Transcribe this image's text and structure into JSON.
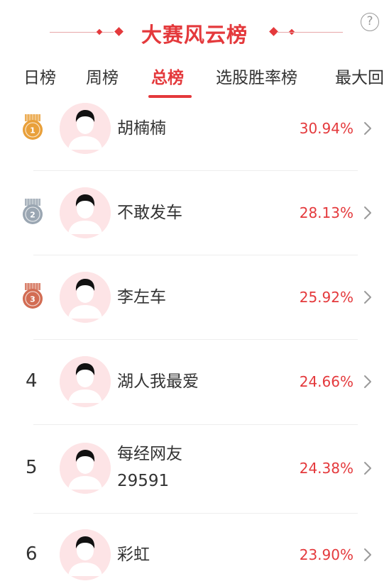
{
  "header": {
    "title": "大赛风云榜",
    "help_symbol": "?"
  },
  "tabs": [
    {
      "label": "日榜",
      "active": false
    },
    {
      "label": "周榜",
      "active": false
    },
    {
      "label": "总榜",
      "active": true
    },
    {
      "label": "选股胜率榜",
      "active": false
    },
    {
      "label": "最大回",
      "active": false
    }
  ],
  "colors": {
    "accent": "#e4393c",
    "gold": "#e9a03a",
    "silver": "#9aa6b2",
    "bronze": "#d26c53",
    "avatar_bg": "#fde4e6"
  },
  "ranking": [
    {
      "rank": "1",
      "medal": "gold",
      "name": "胡楠楠",
      "name_line2": "",
      "rate": "30.94%"
    },
    {
      "rank": "2",
      "medal": "silver",
      "name": "不敢发车",
      "name_line2": "",
      "rate": "28.13%"
    },
    {
      "rank": "3",
      "medal": "bronze",
      "name": "李左车",
      "name_line2": "",
      "rate": "25.92%"
    },
    {
      "rank": "4",
      "medal": "",
      "name": "湖人我最爱",
      "name_line2": "",
      "rate": "24.66%"
    },
    {
      "rank": "5",
      "medal": "",
      "name": "每经网友",
      "name_line2": "29591",
      "rate": "24.38%"
    },
    {
      "rank": "6",
      "medal": "",
      "name": "彩虹",
      "name_line2": "",
      "rate": "23.90%"
    }
  ],
  "icons": {
    "help": "question-circle-icon",
    "chevron": "chevron-right-icon",
    "medal": "medal-icon",
    "avatar": "default-avatar-icon"
  }
}
